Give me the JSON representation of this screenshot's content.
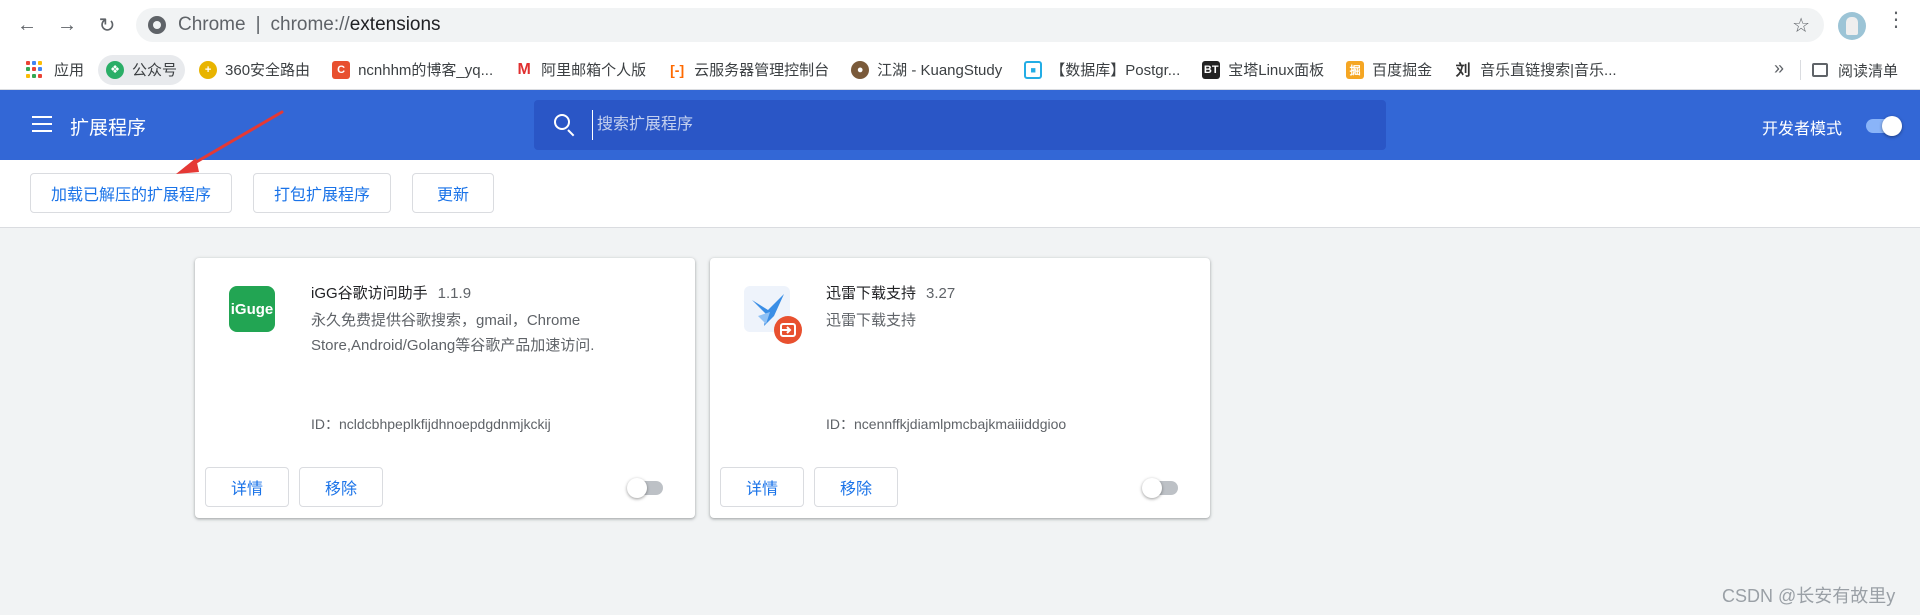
{
  "browser": {
    "omnibox": {
      "site_name": "Chrome",
      "separator": "|",
      "url_scheme": "chrome://",
      "url_host": "extensions"
    },
    "bookmarks": [
      {
        "label": "应用",
        "icon": "apps-grid-icon"
      },
      {
        "label": "公众号",
        "icon": "wechat-icon",
        "color": "#2aae67"
      },
      {
        "label": "360安全路由",
        "icon": "360-icon",
        "color": "#e8b400"
      },
      {
        "label": "ncnhhm的博客_yq...",
        "icon": "csdn-icon",
        "color": "#e8502f"
      },
      {
        "label": "阿里邮箱个人版",
        "icon": "mail-icon",
        "color": "#e03030"
      },
      {
        "label": "云服务器管理控制台",
        "icon": "aliyun-icon",
        "color": "#ff6a00"
      },
      {
        "label": "江湖 - KuangStudy",
        "icon": "kuang-icon",
        "color": "#7a5a3a"
      },
      {
        "label": "【数据库】Postgr...",
        "icon": "bilibili-icon",
        "color": "#23ade5"
      },
      {
        "label": "宝塔Linux面板",
        "icon": "bt-icon",
        "color": "#20a53a"
      },
      {
        "label": "百度掘金",
        "icon": "juejin-icon",
        "color": "#f5a623"
      },
      {
        "label": "音乐直链搜索|音乐...",
        "icon": "music-icon",
        "color": "#333333"
      }
    ],
    "overflow_label": "»",
    "reading_list_label": "阅读清单"
  },
  "extensions_page": {
    "title": "扩展程序",
    "search_placeholder": "搜索扩展程序",
    "dev_mode_label": "开发者模式",
    "dev_mode_on": true,
    "actions": {
      "load_unpacked": "加载已解压的扩展程序",
      "pack": "打包扩展程序",
      "update": "更新"
    },
    "cards": [
      {
        "name": "iGG谷歌访问助手",
        "version": "1.1.9",
        "icon_text": "iGuge",
        "description": "永久免费提供谷歌搜索，gmail，Chrome Store,Android/Golang等谷歌产品加速访问.",
        "id_label": "ID：ncldcbhpeplkfijdhnoepdgdnmjkckij",
        "details_label": "详情",
        "remove_label": "移除",
        "enabled": false
      },
      {
        "name": "迅雷下载支持",
        "version": "3.27",
        "description": "迅雷下载支持",
        "id_label": "ID：ncennffkjdiamlpmcbajkmaiiiddgioo",
        "details_label": "详情",
        "remove_label": "移除",
        "enabled": false
      }
    ]
  },
  "watermark": "CSDN @长安有故里y",
  "colors": {
    "header_blue": "#3367d6",
    "accent": "#1a73e8",
    "annotation_red": "#e53935"
  }
}
